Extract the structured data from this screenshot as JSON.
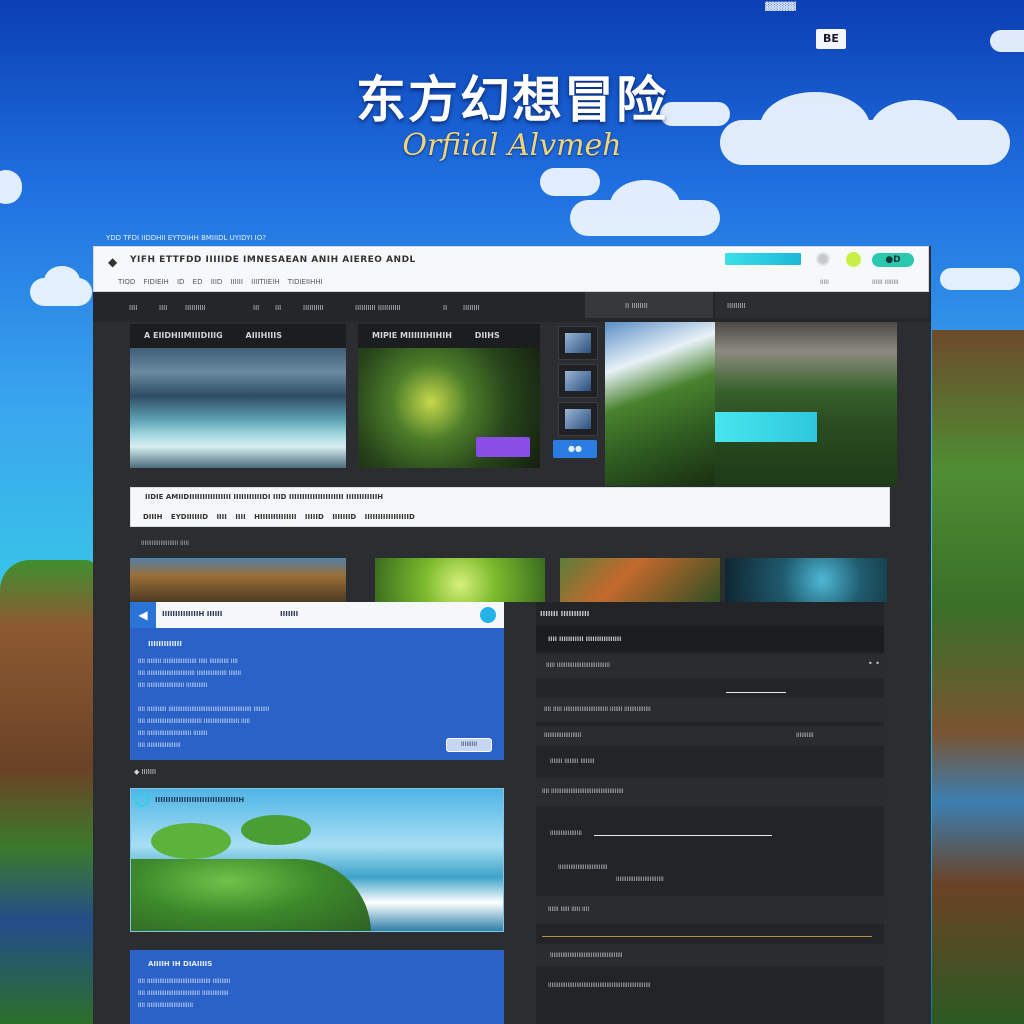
{
  "hero": {
    "title": "东方幻想冒险",
    "subtitle": "Orfiial Alvmeh",
    "lang": "BE",
    "topbadge": "▓▓▓▓▓"
  },
  "overlay_caption": "YDD TFDI IIDDHII EYTOIHH BMIIIDL UYIDYI IO?",
  "window": {
    "app_icon": "◆",
    "title": "YIFH ETTFDD IIIIIDE IMNESAEAN ANIH AIEREO ANDL",
    "menu": "TIOD FIDIEIH ID ED IIID IIIIII IIIITIIEIH TIDIEIIHHI",
    "toggle_label": "●D",
    "right_a": "IIIII",
    "right_b": "IIIIII IIIIIIII"
  },
  "nav": [
    "IIII",
    "IIII",
    "IIIIIIIIII",
    "III",
    "III",
    "IIIIIIIIII",
    "IIIIIIIIII IIIIIIIIIII",
    "II",
    "IIIIIIII",
    "II IIIIIIII",
    "IIIIIIIII"
  ],
  "cards": [
    {
      "title": "A EIIDHIIMIIIDIIIG",
      "title2": "AIIIHIIIS"
    },
    {
      "title": "MIPIE MIIIIIIHIHIH",
      "title2": "DIIHS"
    }
  ],
  "thumb_btn": "●●",
  "caption": {
    "line1": "IIDIE AMIIDIIIIIIIIIIIIIIII IIIIIIIIIIIDI IIID IIIIIIIIIIIIIIIIIIIII IIIIIIIIIIIIH",
    "line2": "DIIIH EYDIIIIIID IIII IIII HIIIIIIIIIIIIII IIIIID IIIIIIID IIIIIIIIIIIIIIIIID"
  },
  "row_label": "IIIIIIIIIIIIIIIIIIIII IIIII",
  "blue_panel": {
    "icon": "◀",
    "title": "IIIIIIIIIIIIIIH IIIIII",
    "title2": "IIIIIII",
    "section": "IIIIIIIIIIIII",
    "lines": [
      "IIII IIIIIIII IIIIIIIIIIIIIIIIIII IIIII IIIIIIIIIII IIII",
      "IIII IIIIIIIIIIIIIIIIIIIIIIIIIII IIIIIIIIIIIIIIIII IIIIIII",
      "IIII IIIIIIIIIIIIIIIIIIIII IIIIIIIIIIII",
      "IIII IIIIIIIIIII IIIIIIIIIIIIIIIIIIIIIIIIIIIIIIIIIIIIIIIIIIIIIII IIIIIIIII",
      "IIII IIIIIIIIIIIIIIIIIIIIIIIIIIIIIII IIIIIIIIIIIIIIIIIIII IIIII",
      "IIII IIIIIIIIIIIIIIIIIIIIIIIII IIIIIIII",
      "IIII IIIIIIIIIIIIIIIIIII"
    ],
    "button": "IIIIIIIII"
  },
  "side_label": "◆ IIIIIII",
  "tropical_title": "IIIIIIIIIIIIIIIIIIIIIIIIIIIIIIIIH",
  "blue_panel2": {
    "section": "AIIIIH IH DIAIIIIS",
    "lines": [
      "IIII IIIIIIIIIIIIIIIIIIIIIIIIIIIIIIIIIIII IIIIIIIIII",
      "IIII IIIIIIIIIIIIIIIIIIIIIIIIIIIIII IIIIIIIIIIIIIII",
      "IIII IIIIIIIIIIIIIIIIIIIIIIIIII"
    ]
  },
  "right_panel": {
    "title": "IIIIIII IIIIIIIIIII",
    "head": "IIII IIIIIIIIIII IIIIIIIIIIIIIIII",
    "rows": [
      "IIIII IIIIIIIIIIIIIIIIIIIIIIIIIIIIII",
      "IIII IIIII IIIIIIIIIIIIIIIIIIIIIIIII IIIIIII IIIIIIIIIIIIIII",
      "IIIIIIIIIIIIIIIIIIIII",
      "IIIIIIIIII",
      "IIIIIII IIIIIIII IIIIIIII",
      "IIII IIIIIIIIIIIIIIIIIIIIIIIIIIIIIIIIIIIIIIIII",
      "IIIIIIIIIIIIIIIIII",
      "IIIIIIIIIIIIIIIIIIIIIIIIIIII",
      "IIIIIIIIIIIIIIIIIIIIIIIIIII",
      "IIIIII IIIII IIIII IIII",
      "IIIIIIIIIIIIIIIIIIIIIIIIIIIIIIIIIIIIIIIII",
      "IIIIIIIIIIIIIIIIIIIIIIIIIIIIIIIIIIIIIIIIIIIIIIIIIIIIIIIIII"
    ],
    "dots": "• •"
  }
}
